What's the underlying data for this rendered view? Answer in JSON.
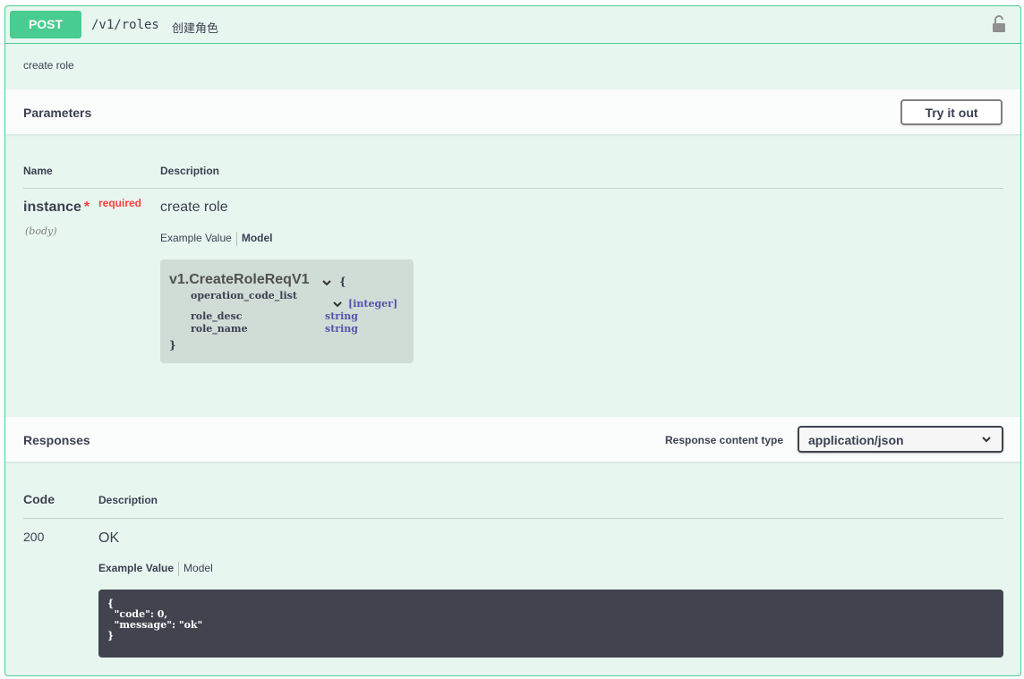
{
  "operation": {
    "method": "POST",
    "path": "/v1/roles",
    "summary": "创建角色",
    "description": "create role"
  },
  "parameters": {
    "title": "Parameters",
    "try_button": "Try it out",
    "col_name": "Name",
    "col_description": "Description",
    "items": [
      {
        "name": "instance",
        "star": "*",
        "required": "required",
        "in": "(body)",
        "description": "create role",
        "tabs": {
          "example": "Example Value",
          "model": "Model"
        },
        "model": {
          "name": "v1.CreateRoleReqV1",
          "open_brace": "{",
          "close_brace": "}",
          "properties": [
            {
              "name": "operation_code_list",
              "type": "[integer]"
            },
            {
              "name": "role_desc",
              "type": "string"
            },
            {
              "name": "role_name",
              "type": "string"
            }
          ]
        }
      }
    ]
  },
  "responses": {
    "title": "Responses",
    "content_type_label": "Response content type",
    "content_type_value": "application/json",
    "col_code": "Code",
    "col_description": "Description",
    "items": [
      {
        "code": "200",
        "description": "OK",
        "tabs": {
          "example": "Example Value",
          "model": "Model"
        },
        "example": "{\n  \"code\": 0,\n  \"message\": \"ok\"\n}"
      }
    ]
  },
  "colors": {
    "post_green": "#49cc90",
    "required_red": "#f93e3e",
    "type_blue": "#55a",
    "example_bg": "#41444e"
  },
  "icons": [
    "unlock-icon",
    "chevron-down-icon"
  ]
}
